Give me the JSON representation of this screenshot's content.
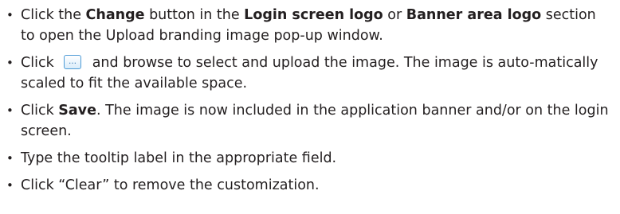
{
  "bullets": {
    "symbol": "•",
    "item1": {
      "t1": "Click the ",
      "b1": "Change",
      "t2": " button in the ",
      "b2": "Login screen logo",
      "t3": " or ",
      "b3": "Banner area logo",
      "t4": " section to open the Upload branding image pop-up window."
    },
    "item2": {
      "t1": "Click",
      "button_icon": "…",
      "t2": "and browse to select and upload the image. The image is auto-matically scaled to fit the available space."
    },
    "item3": {
      "t1": "Click ",
      "b1": "Save",
      "t2": ". The image is now included in the application banner and/or on the login screen."
    },
    "item4": {
      "t1": "Type the tooltip label in the appropriate field."
    },
    "item5": {
      "t1": "Click “Clear” to remove the customization."
    }
  },
  "colors": {
    "text": "#231f20",
    "button_border": "#4d9bd6",
    "button_fill_bottom": "#d9ecfa"
  }
}
